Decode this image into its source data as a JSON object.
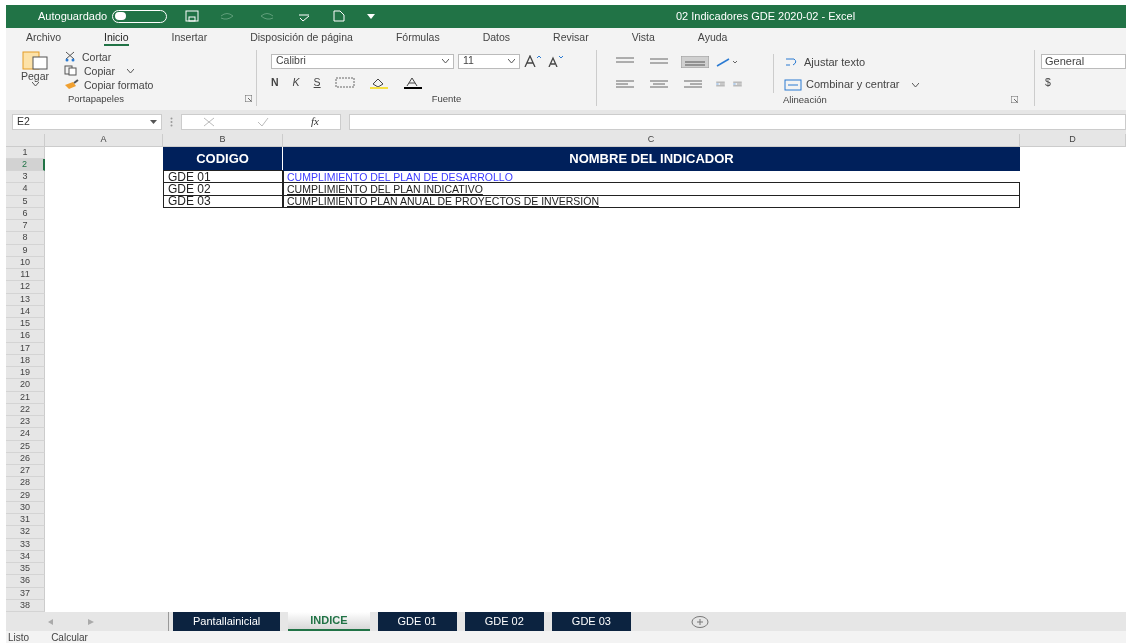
{
  "window": {
    "title": "02 Indicadores GDE 2020-02  -  Excel"
  },
  "quick_access": {
    "autosave_label": "Autoguardado",
    "autosave_on": false
  },
  "menu_tabs": [
    {
      "label": "Archivo",
      "selected": false
    },
    {
      "label": "Inicio",
      "selected": true
    },
    {
      "label": "Insertar",
      "selected": false
    },
    {
      "label": "Disposición de página",
      "selected": false
    },
    {
      "label": "Fórmulas",
      "selected": false
    },
    {
      "label": "Datos",
      "selected": false
    },
    {
      "label": "Revisar",
      "selected": false
    },
    {
      "label": "Vista",
      "selected": false
    },
    {
      "label": "Ayuda",
      "selected": false
    }
  ],
  "ribbon": {
    "clipboard": {
      "paste": "Pegar",
      "cut": "Cortar",
      "copy": "Copiar",
      "format_painter": "Copiar formato",
      "label": "Portapapeles"
    },
    "font": {
      "name": "Calibri",
      "size": "11",
      "bold": "N",
      "italic": "K",
      "underline": "S",
      "label": "Fuente"
    },
    "alignment": {
      "wrap": "Ajustar texto",
      "merge": "Combinar y centrar",
      "label": "Alineación"
    },
    "number": {
      "format": "General",
      "currency": "$"
    }
  },
  "formula_bar": {
    "name_box": "E2",
    "fx": "fx"
  },
  "sheet": {
    "columns": [
      "A",
      "B",
      "C",
      "D"
    ],
    "row_headers": [
      {
        "label": "1",
        "selected": false
      },
      {
        "label": "2",
        "selected": true
      },
      {
        "label": "3",
        "selected": false
      },
      {
        "label": "4",
        "selected": false
      },
      {
        "label": "5",
        "selected": false
      },
      {
        "label": "6",
        "selected": false
      },
      {
        "label": "7",
        "selected": false
      },
      {
        "label": "8",
        "selected": false
      },
      {
        "label": "9",
        "selected": false
      },
      {
        "label": "10",
        "selected": false
      },
      {
        "label": "11",
        "selected": false
      },
      {
        "label": "12",
        "selected": false
      },
      {
        "label": "13",
        "selected": false
      },
      {
        "label": "14",
        "selected": false
      },
      {
        "label": "15",
        "selected": false
      },
      {
        "label": "16",
        "selected": false
      },
      {
        "label": "17",
        "selected": false
      },
      {
        "label": "18",
        "selected": false
      },
      {
        "label": "19",
        "selected": false
      },
      {
        "label": "20",
        "selected": false
      },
      {
        "label": "21",
        "selected": false
      },
      {
        "label": "22",
        "selected": false
      },
      {
        "label": "23",
        "selected": false
      },
      {
        "label": "24",
        "selected": false
      },
      {
        "label": "25",
        "selected": false
      },
      {
        "label": "26",
        "selected": false
      },
      {
        "label": "27",
        "selected": false
      },
      {
        "label": "28",
        "selected": false
      },
      {
        "label": "29",
        "selected": false
      },
      {
        "label": "30",
        "selected": false
      },
      {
        "label": "31",
        "selected": false
      },
      {
        "label": "32",
        "selected": false
      },
      {
        "label": "33",
        "selected": false
      },
      {
        "label": "34",
        "selected": false
      },
      {
        "label": "35",
        "selected": false
      },
      {
        "label": "36",
        "selected": false
      },
      {
        "label": "37",
        "selected": false
      },
      {
        "label": "38",
        "selected": false
      }
    ],
    "header": {
      "code": "CODIGO",
      "name": "NOMBRE DEL INDICADOR"
    },
    "rows": [
      {
        "code": "GDE 01",
        "name": "CUMPLIMIENTO DEL PLAN DE DESARROLLO",
        "kind": "link"
      },
      {
        "code": "GDE 02",
        "name": "CUMPLIMIENTO DEL PLAN INDICATIVO",
        "kind": "text"
      },
      {
        "code": "GDE 03",
        "name": "CUMPLIMIENTO PLAN ANUAL DE PROYECTOS DE INVERSIÓN",
        "kind": "text"
      }
    ]
  },
  "sheet_tabs": [
    {
      "label": "Pantallainicial",
      "selected": false
    },
    {
      "label": "INDICE",
      "selected": true
    },
    {
      "label": "GDE 01",
      "selected": false
    },
    {
      "label": "GDE 02",
      "selected": false
    },
    {
      "label": "GDE 03",
      "selected": false
    }
  ],
  "status_bar": [
    "Listo",
    "Calcular"
  ]
}
